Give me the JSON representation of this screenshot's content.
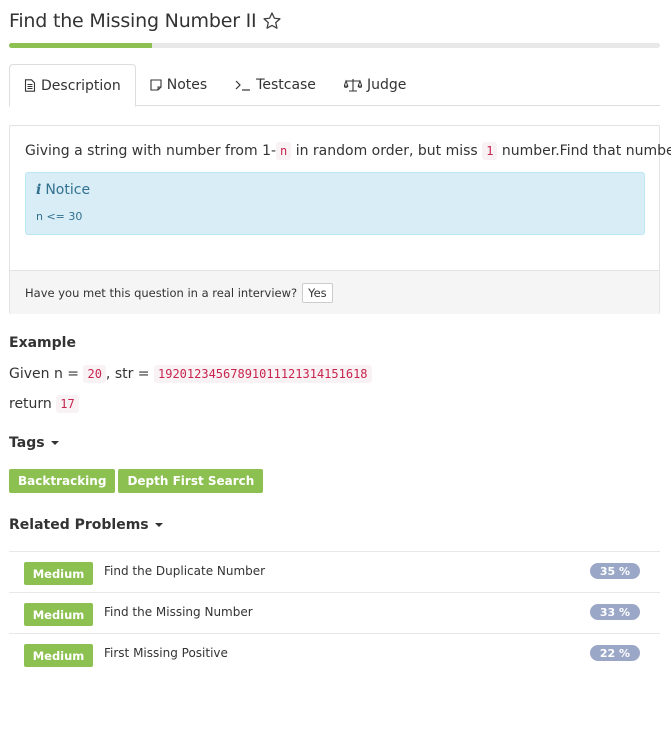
{
  "problem": {
    "title": "Find the Missing Number II",
    "progress_percent": 22
  },
  "tabs": [
    {
      "label": "Description",
      "icon": "document-icon"
    },
    {
      "label": "Notes",
      "icon": "note-icon"
    },
    {
      "label": "Testcase",
      "icon": "terminal-icon"
    },
    {
      "label": "Judge",
      "icon": "scale-icon"
    }
  ],
  "description": {
    "text_1": "Giving a string with number from 1-",
    "code_n": "n",
    "text_2": " in random order, but miss ",
    "code_1": "1",
    "text_3": " number.Find that number."
  },
  "notice": {
    "icon": "info-icon",
    "title": "Notice",
    "body": "n <= 30"
  },
  "interview": {
    "question": "Have you met this question in a real interview?",
    "yes_label": "Yes"
  },
  "example": {
    "heading": "Example",
    "given_prefix": "Given n = ",
    "n_value": "20",
    "str_prefix": ", str = ",
    "str_value": "19201234567891011121314151618",
    "return_prefix": "return ",
    "return_value": "17"
  },
  "tags_section": {
    "heading": "Tags",
    "items": [
      "Backtracking",
      "Depth First Search"
    ]
  },
  "related_section": {
    "heading": "Related Problems",
    "items": [
      {
        "difficulty": "Medium",
        "name": "Find the Duplicate Number",
        "rate": "35 %"
      },
      {
        "difficulty": "Medium",
        "name": "Find the Missing Number",
        "rate": "33 %"
      },
      {
        "difficulty": "Medium",
        "name": "First Missing Positive",
        "rate": "22 %"
      }
    ]
  },
  "colors": {
    "accent_green": "#8cc152",
    "rate_badge": "#9aa7c6",
    "notice_bg": "#d9edf7",
    "notice_text": "#31708f",
    "code_text": "#c7254e"
  }
}
